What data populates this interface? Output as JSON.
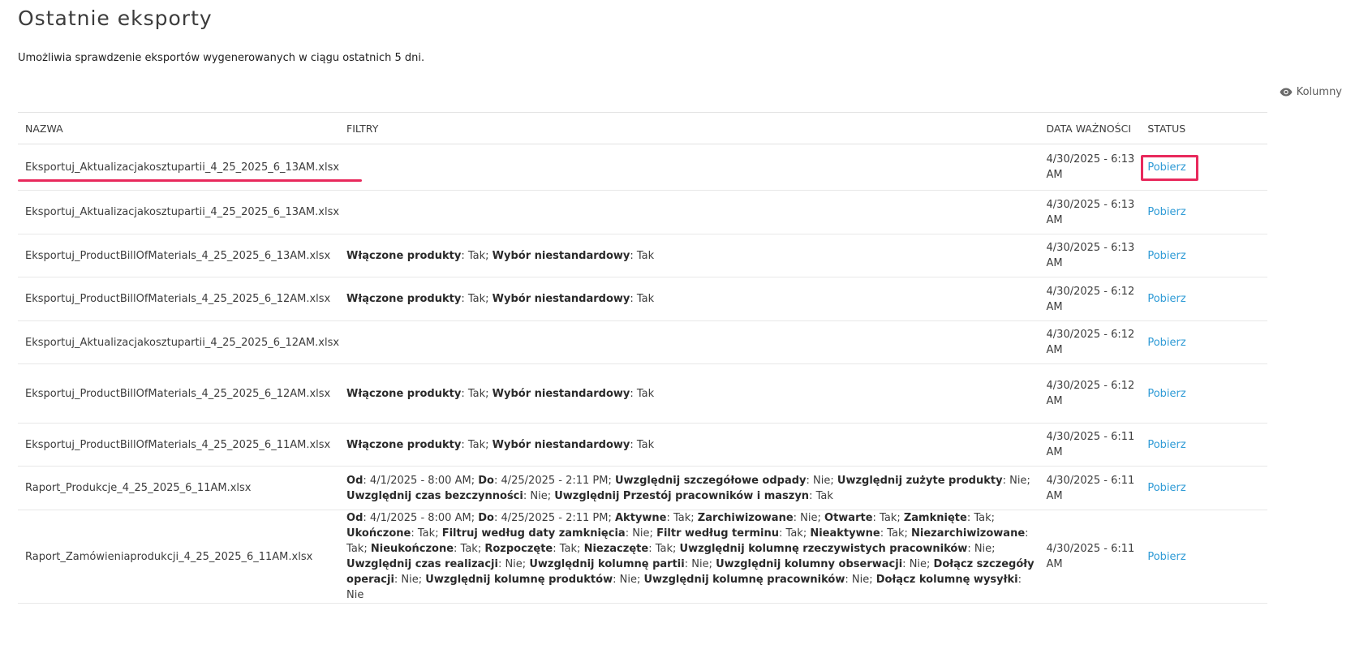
{
  "page": {
    "title": "Ostatnie eksporty",
    "subtitle": "Umożliwia sprawdzenie eksportów wygenerowanych w ciągu ostatnich 5 dni.",
    "columns_button": "Kolumny"
  },
  "table": {
    "headers": {
      "name": "NAZWA",
      "filters": "FILTRY",
      "expiry": "DATA WAŻNOŚCI",
      "status": "STATUS"
    },
    "rows": [
      {
        "name": "Eksportuj_Aktualizacjakosztupartii_4_25_2025_6_13AM.xlsx",
        "filters": [],
        "date": "4/30/2025 - 6:13 AM",
        "action": "Pobierz"
      },
      {
        "name": "Eksportuj_Aktualizacjakosztupartii_4_25_2025_6_13AM.xlsx",
        "filters": [],
        "date": "4/30/2025 - 6:13 AM",
        "action": "Pobierz"
      },
      {
        "name": "Eksportuj_ProductBillOfMaterials_4_25_2025_6_13AM.xlsx",
        "filters": [
          [
            "Włączone produkty",
            "Tak"
          ],
          [
            "Wybór niestandardowy",
            "Tak"
          ]
        ],
        "date": "4/30/2025 - 6:13 AM",
        "action": "Pobierz"
      },
      {
        "name": "Eksportuj_ProductBillOfMaterials_4_25_2025_6_12AM.xlsx",
        "filters": [
          [
            "Włączone produkty",
            "Tak"
          ],
          [
            "Wybór niestandardowy",
            "Tak"
          ]
        ],
        "date": "4/30/2025 - 6:12 AM",
        "action": "Pobierz"
      },
      {
        "name": "Eksportuj_Aktualizacjakosztupartii_4_25_2025_6_12AM.xlsx",
        "filters": [],
        "date": "4/30/2025 - 6:12 AM",
        "action": "Pobierz"
      },
      {
        "name": "Eksportuj_ProductBillOfMaterials_4_25_2025_6_12AM.xlsx",
        "filters": [
          [
            "Włączone produkty",
            "Tak"
          ],
          [
            "Wybór niestandardowy",
            "Tak"
          ]
        ],
        "date": "4/30/2025 - 6:12 AM",
        "action": "Pobierz"
      },
      {
        "name": "Eksportuj_ProductBillOfMaterials_4_25_2025_6_11AM.xlsx",
        "filters": [
          [
            "Włączone produkty",
            "Tak"
          ],
          [
            "Wybór niestandardowy",
            "Tak"
          ]
        ],
        "date": "4/30/2025 - 6:11 AM",
        "action": "Pobierz"
      },
      {
        "name": "Raport_Produkcje_4_25_2025_6_11AM.xlsx",
        "filters": [
          [
            "Od",
            "4/1/2025 - 8:00 AM"
          ],
          [
            "Do",
            "4/25/2025 - 2:11 PM"
          ],
          [
            "Uwzględnij szczegółowe odpady",
            "Nie"
          ],
          [
            "Uwzględnij zużyte produkty",
            "Nie"
          ],
          [
            "Uwzględnij czas bezczynności",
            "Nie"
          ],
          [
            "Uwzględnij Przestój pracowników i maszyn",
            "Tak"
          ]
        ],
        "date": "4/30/2025 - 6:11 AM",
        "action": "Pobierz"
      },
      {
        "name": "Raport_Zamówieniaprodukcji_4_25_2025_6_11AM.xlsx",
        "filters": [
          [
            "Od",
            "4/1/2025 - 8:00 AM"
          ],
          [
            "Do",
            "4/25/2025 - 2:11 PM"
          ],
          [
            "Aktywne",
            "Tak"
          ],
          [
            "Zarchiwizowane",
            "Nie"
          ],
          [
            "Otwarte",
            "Tak"
          ],
          [
            "Zamknięte",
            "Tak"
          ],
          [
            "Ukończone",
            "Tak"
          ],
          [
            "Filtruj według daty zamknięcia",
            "Nie"
          ],
          [
            "Filtr według terminu",
            "Tak"
          ],
          [
            "Nieaktywne",
            "Tak"
          ],
          [
            "Niezarchiwizowane",
            "Tak"
          ],
          [
            "Nieukończone",
            "Tak"
          ],
          [
            "Rozpoczęte",
            "Tak"
          ],
          [
            "Niezaczęte",
            "Tak"
          ],
          [
            "Uwzględnij kolumnę rzeczywistych pracowników",
            "Nie"
          ],
          [
            "Uwzględnij czas realizacji",
            "Nie"
          ],
          [
            "Uwzględnij kolumnę partii",
            "Nie"
          ],
          [
            "Uwzględnij kolumny obserwacji",
            "Nie"
          ],
          [
            "Dołącz szczegóły operacji",
            "Nie"
          ],
          [
            "Uwzględnij kolumnę produktów",
            "Nie"
          ],
          [
            "Uwzględnij kolumnę pracowników",
            "Nie"
          ],
          [
            "Dołącz kolumnę wysyłki",
            "Nie"
          ]
        ],
        "date": "4/30/2025 - 6:11 AM",
        "action": "Pobierz"
      }
    ]
  },
  "colors": {
    "link": "#2f9bd6",
    "highlight": "#e8295c",
    "text": "#3c3c3c",
    "border": "#e3e3e3"
  },
  "icons": {
    "columns": "eye-icon"
  }
}
